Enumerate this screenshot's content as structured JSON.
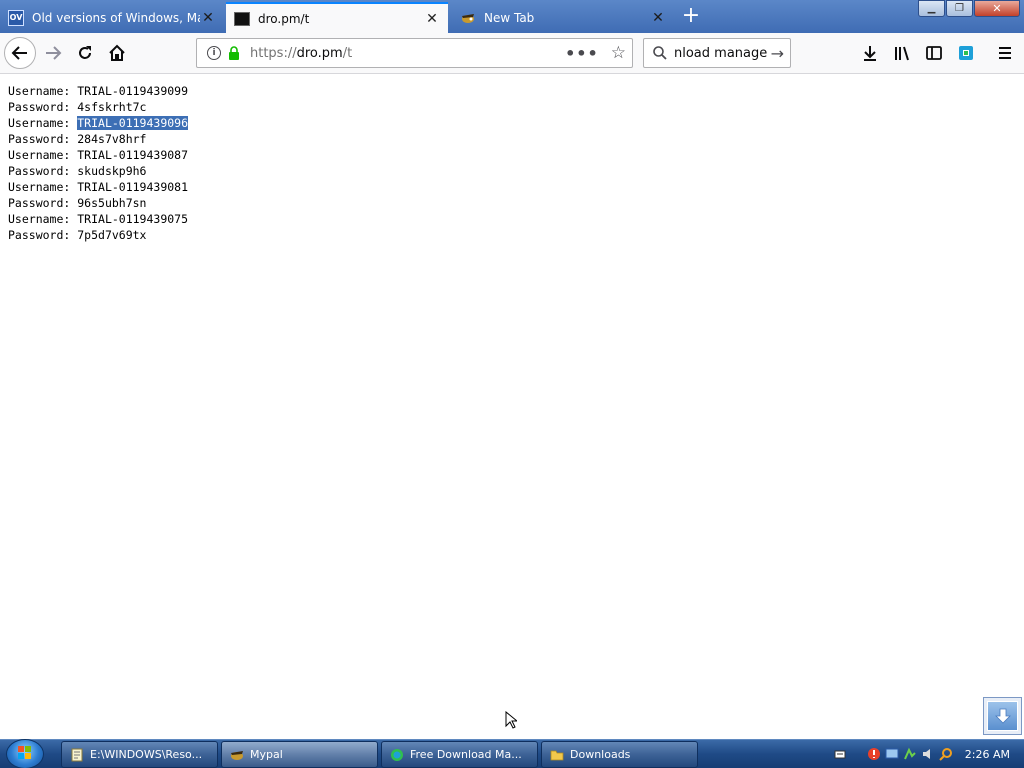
{
  "browser": {
    "tabs": [
      {
        "title": "Old versions of Windows, Mac",
        "favicon": "ov"
      },
      {
        "title": "dro.pm/t",
        "favicon": "dro"
      },
      {
        "title": "New Tab",
        "favicon": "mypal"
      }
    ],
    "active_tab": 1,
    "url_prefix": "https://",
    "url_domain": "dro.pm",
    "url_path": "/t",
    "search_text": "nload manage"
  },
  "page": {
    "credentials": [
      {
        "label": "Username:",
        "value": "TRIAL-0119439099"
      },
      {
        "label": "Password:",
        "value": "4sfskrht7c"
      },
      {
        "label": "Username:",
        "value": "TRIAL-0119439096",
        "selected": true
      },
      {
        "label": "Password:",
        "value": "284s7v8hrf"
      },
      {
        "label": "Username:",
        "value": "TRIAL-0119439087"
      },
      {
        "label": "Password:",
        "value": "skudskp9h6"
      },
      {
        "label": "Username:",
        "value": "TRIAL-0119439081"
      },
      {
        "label": "Password:",
        "value": "96s5ubh7sn"
      },
      {
        "label": "Username:",
        "value": "TRIAL-0119439075"
      },
      {
        "label": "Password:",
        "value": "7p5d7v69tx"
      }
    ]
  },
  "taskbar": {
    "tasks": [
      {
        "label": "E:\\WINDOWS\\Reso...",
        "icon": "notepad-icon"
      },
      {
        "label": "Mypal",
        "icon": "mypal-icon"
      },
      {
        "label": "Free Download Ma...",
        "icon": "fdm-icon"
      },
      {
        "label": "Downloads",
        "icon": "folder-icon"
      }
    ],
    "clock": "2:26 AM"
  },
  "colors": {
    "tabstrip": "#4a78bd",
    "selection": "#3d6fb5",
    "accent": "#0a84ff"
  }
}
